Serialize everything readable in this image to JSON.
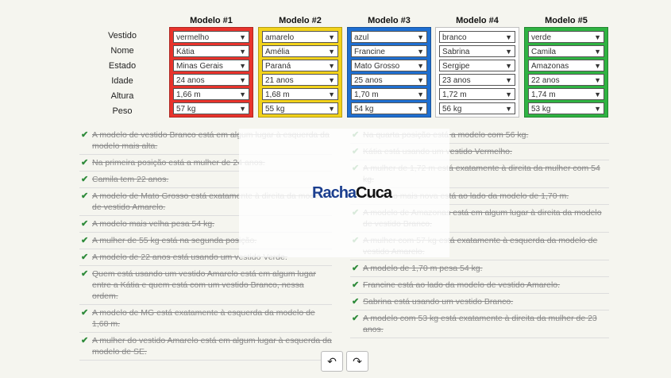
{
  "row_labels": [
    "Vestido",
    "Nome",
    "Estado",
    "Idade",
    "Altura",
    "Peso"
  ],
  "models": [
    {
      "title": "Modelo #1",
      "color": "#e8332c",
      "values": [
        "vermelho",
        "Kátia",
        "Minas Gerais",
        "24 anos",
        "1,66 m",
        "57 kg"
      ]
    },
    {
      "title": "Modelo #2",
      "color": "#f2d21b",
      "values": [
        "amarelo",
        "Amélia",
        "Paraná",
        "21 anos",
        "1,68 m",
        "55 kg"
      ]
    },
    {
      "title": "Modelo #3",
      "color": "#1f6fd1",
      "values": [
        "azul",
        "Francine",
        "Mato Grosso",
        "25 anos",
        "1,70 m",
        "54 kg"
      ]
    },
    {
      "title": "Modelo #4",
      "color": "#ffffff",
      "values": [
        "branco",
        "Sabrina",
        "Sergipe",
        "23 anos",
        "1,72 m",
        "56 kg"
      ]
    },
    {
      "title": "Modelo #5",
      "color": "#2fb342",
      "values": [
        "verde",
        "Camila",
        "Amazonas",
        "22 anos",
        "1,74 m",
        "53 kg"
      ]
    }
  ],
  "clues_left": [
    "A modelo de vestido Branco está em algum lugar à esquerda da modelo mais alta.",
    "Na primeira posição está a mulher de 24 anos.",
    "Camila tem 22 anos.",
    "A modelo de Mato Grosso está exatamente à direita da modelo de vestido Amarelo.",
    "A modelo mais velha pesa 54 kg.",
    "A mulher de 55 kg está na segunda posição.",
    "A modelo de 22 anos está usando um vestido Verde.",
    "Quem está usando um vestido Amarelo está em algum lugar entre a Kátia e quem está com um vestido Branco, nessa ordem.",
    "A modelo de MG está exatamente à esquerda da modelo de 1,68 m.",
    "A mulher do vestido Amarelo está em algum lugar à esquerda da modelo de SE."
  ],
  "clues_right": [
    "Na quarta posição está a modelo com 56 kg.",
    "Kátia está usando um vestido Vermelho.",
    "A mulher de 1,72 m está exatamente à direita da mulher com 54 kg.",
    "A modelo mais nova está ao lado da modelo de 1,70 m.",
    "A modelo de Amazonas está em algum lugar à direita da modelo de vestido Branco.",
    "A mulher com 57 kg está exatamente à esquerda da modelo de vestido Amarelo.",
    "A modelo de 1,70 m pesa 54 kg.",
    "Francine está ao lado da modelo de vestido Amarelo.",
    "Sabrina está usando um vestido Branco.",
    "A modelo com 53 kg está exatamente à direita da mulher de 23 anos."
  ],
  "logo": {
    "part1": "Racha",
    "part2": "Cuca"
  },
  "controls": {
    "undo_icon": "undo-icon",
    "redo_icon": "redo-icon",
    "undo_glyph": "↶",
    "redo_glyph": "↷"
  }
}
